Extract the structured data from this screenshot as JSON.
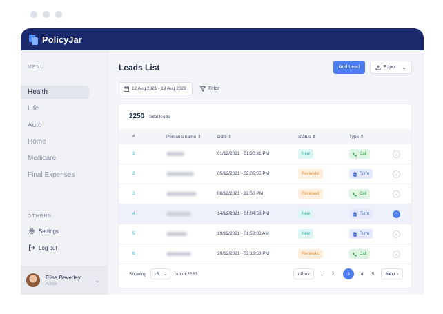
{
  "app": {
    "name": "PolicyJar"
  },
  "sidebar": {
    "menu_label": "MENU",
    "items": [
      {
        "label": "Health",
        "active": true
      },
      {
        "label": "Life"
      },
      {
        "label": "Auto"
      },
      {
        "label": "Home"
      },
      {
        "label": "Medicare"
      },
      {
        "label": "Final Expenses"
      }
    ],
    "others_label": "OTHERS",
    "settings_label": "Settings",
    "logout_label": "Log out",
    "user": {
      "name": "Elise Beverley",
      "role": "Admin"
    }
  },
  "header": {
    "title": "Leads List",
    "add_label": "Add Lead",
    "export_label": "Export"
  },
  "filters": {
    "date_range": "12 Aug 2021 - 19 Aug 2021",
    "filter_label": "Filter"
  },
  "summary": {
    "total": "2250",
    "total_label": "Total leads"
  },
  "table": {
    "columns": [
      "#",
      "Person's name",
      "Date",
      "Status",
      "Type"
    ],
    "rows": [
      {
        "idx": "1",
        "date": "01/12/2021 - 01:30:31 PM",
        "status": "New",
        "type": "Call"
      },
      {
        "idx": "2",
        "date": "05/12/2021 - 02:05:55 PM",
        "status": "Reviewed",
        "type": "Form"
      },
      {
        "idx": "3",
        "date": "08/12/2021 - 22:50 PM",
        "status": "Reviewed",
        "type": "Call"
      },
      {
        "idx": "4",
        "date": "14/12/2021 - 01:04:58 PM",
        "status": "New",
        "type": "Form"
      },
      {
        "idx": "5",
        "date": "19/12/2021 - 01:59:03 AM",
        "status": "New",
        "type": "Form"
      },
      {
        "idx": "6",
        "date": "20/12/2021 - 02:18:53 PM",
        "status": "Reviewed",
        "type": "Call"
      }
    ]
  },
  "pagination": {
    "showing_label": "Showing",
    "per_page": "15",
    "out_of": "out of 2250",
    "prev_label": "Prev",
    "next_label": "Next",
    "pages": [
      "1",
      "2",
      "3",
      "4",
      "5"
    ],
    "current": "3"
  },
  "colors": {
    "brand": "#1a2a6c",
    "accent": "#4c7df0"
  }
}
